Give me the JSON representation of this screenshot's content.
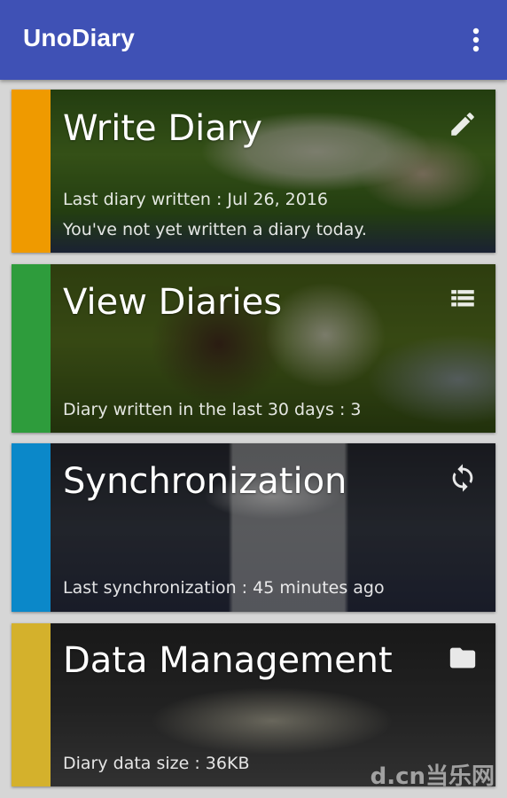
{
  "appbar": {
    "title": "UnoDiary",
    "menu_icon": "more-vert-icon",
    "color": "#3f51b5"
  },
  "cards": [
    {
      "id": "write",
      "title": "Write Diary",
      "icon": "pencil-icon",
      "stripe_color": "#ef9a00",
      "lines": [
        "Last diary written : Jul 26, 2016",
        "You've not yet written a diary today."
      ]
    },
    {
      "id": "view",
      "title": "View Diaries",
      "icon": "list-icon",
      "stripe_color": "#2e9c3c",
      "lines": [
        "Diary written in the last 30 days : 3"
      ]
    },
    {
      "id": "sync",
      "title": "Synchronization",
      "icon": "sync-icon",
      "stripe_color": "#0b88c9",
      "lines": [
        "Last synchronization : 45 minutes ago"
      ]
    },
    {
      "id": "data",
      "title": "Data Management",
      "icon": "folder-icon",
      "stripe_color": "#d4b12c",
      "lines": [
        "Diary data size : 36KB"
      ]
    }
  ],
  "watermark": "d.cn当乐网"
}
